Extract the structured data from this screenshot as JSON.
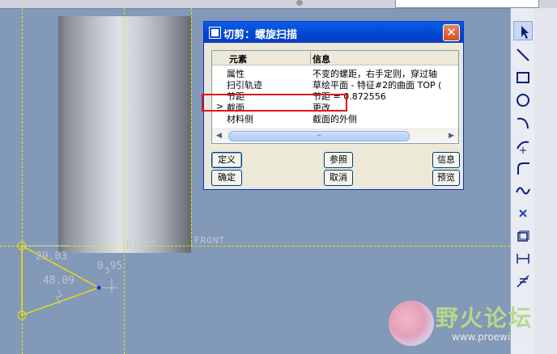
{
  "dialog": {
    "title": "切剪：螺旋扫描",
    "close_label": "✕",
    "columns": {
      "element": "元素",
      "info": "信息"
    },
    "rows": [
      {
        "marker": "",
        "element": "属性",
        "info": "不变的螺距，右手定则，穿过轴"
      },
      {
        "marker": "",
        "element": "扫引轨迹",
        "info": "草绘平面 - 特征#2的曲面 TOP  ("
      },
      {
        "marker": "",
        "element": "节距",
        "info": "节距 = 0.872556"
      },
      {
        "marker": ">",
        "element": "截面",
        "info": "更改"
      },
      {
        "marker": "",
        "element": "材料侧",
        "info": "截面的外侧"
      }
    ],
    "scroll_thumb": "┉",
    "buttons": {
      "define": "定义",
      "refs": "参照",
      "info": "信息",
      "ok": "确定",
      "cancel": "取消",
      "preview": "预览"
    }
  },
  "sketch": {
    "datum_right": "RIGHT",
    "datum_front": "FRONT",
    "dims": [
      "29.03",
      "0.95",
      "48.09"
    ]
  },
  "watermark": {
    "name": "野火论坛",
    "url": "www.proewildfire.cn"
  },
  "colors": {
    "background": "#8299b8",
    "datum_lines": "#f2e400",
    "highlight_box": "#e0161c",
    "titlebar": "#0047d1"
  },
  "toolbar_icons": [
    "select-arrow-icon",
    "line-icon",
    "rectangle-icon",
    "circle-icon",
    "arc-icon",
    "point-icon",
    "fillet-icon",
    "spline-icon",
    "cross-icon",
    "offset-icon",
    "dimension-icon",
    "trim-icon"
  ]
}
